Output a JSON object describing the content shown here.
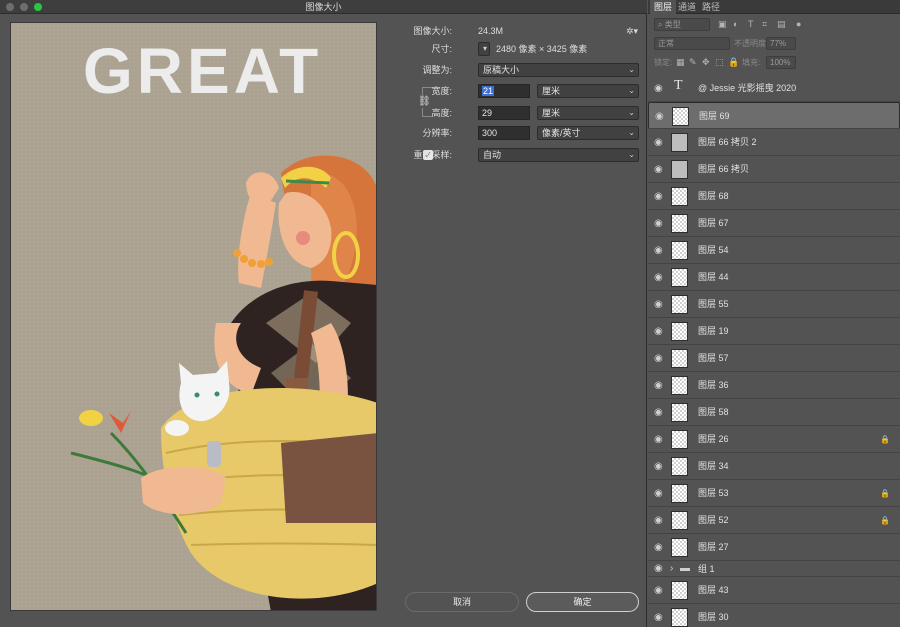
{
  "dialog": {
    "title": "图像大小",
    "image_size_label": "图像大小:",
    "image_size_value": "24.3M",
    "dimensions_label": "尺寸:",
    "dimensions_value": "2480 像素 × 3425 像素",
    "fit_to_label": "调整为:",
    "fit_to_value": "原稿大小",
    "width_label": "宽度:",
    "width_value": "21",
    "width_unit": "厘米",
    "height_label": "高度:",
    "height_value": "29",
    "height_unit": "厘米",
    "resolution_label": "分辨率:",
    "resolution_value": "300",
    "resolution_unit": "像素/英寸",
    "resample_label": "重新采样:",
    "resample_checked": true,
    "resample_value": "自动",
    "cancel_label": "取消",
    "ok_label": "确定"
  },
  "artwork": {
    "text": "GREAT"
  },
  "panel": {
    "tabs": [
      "图层",
      "通道",
      "路径"
    ],
    "filter_placeholder": "类型",
    "blend_mode": "正常",
    "opacity_label": "不透明度:",
    "opacity_value": "77%",
    "lock_label": "锁定:",
    "fill_label": "填充:",
    "fill_value": "100%",
    "layers": [
      {
        "name": "@ Jessie 光影摇曳 2020",
        "type": "text",
        "locked": false
      },
      {
        "name": "图层 69",
        "type": "pixel",
        "locked": false,
        "selected": true
      },
      {
        "name": "图层 66 拷贝 2",
        "type": "pixel",
        "locked": false
      },
      {
        "name": "图层 66 拷贝",
        "type": "pixel",
        "locked": false
      },
      {
        "name": "图层 68",
        "type": "pixel",
        "locked": false
      },
      {
        "name": "图层 67",
        "type": "pixel",
        "locked": false
      },
      {
        "name": "图层 54",
        "type": "pixel",
        "locked": false
      },
      {
        "name": "图层 44",
        "type": "pixel",
        "locked": false
      },
      {
        "name": "图层 55",
        "type": "pixel",
        "locked": false
      },
      {
        "name": "图层 19",
        "type": "pixel",
        "locked": false
      },
      {
        "name": "图层 57",
        "type": "pixel",
        "locked": false
      },
      {
        "name": "图层 36",
        "type": "pixel",
        "locked": false
      },
      {
        "name": "图层 58",
        "type": "pixel",
        "locked": false
      },
      {
        "name": "图层 26",
        "type": "pixel",
        "locked": true
      },
      {
        "name": "图层 34",
        "type": "pixel",
        "locked": false
      },
      {
        "name": "图层 53",
        "type": "pixel",
        "locked": true
      },
      {
        "name": "图层 52",
        "type": "pixel",
        "locked": true
      },
      {
        "name": "图层 27",
        "type": "pixel",
        "locked": false
      },
      {
        "name": "组 1",
        "type": "group",
        "locked": false
      },
      {
        "name": "图层 43",
        "type": "pixel",
        "locked": false
      },
      {
        "name": "图层 30",
        "type": "pixel",
        "locked": false
      }
    ]
  }
}
